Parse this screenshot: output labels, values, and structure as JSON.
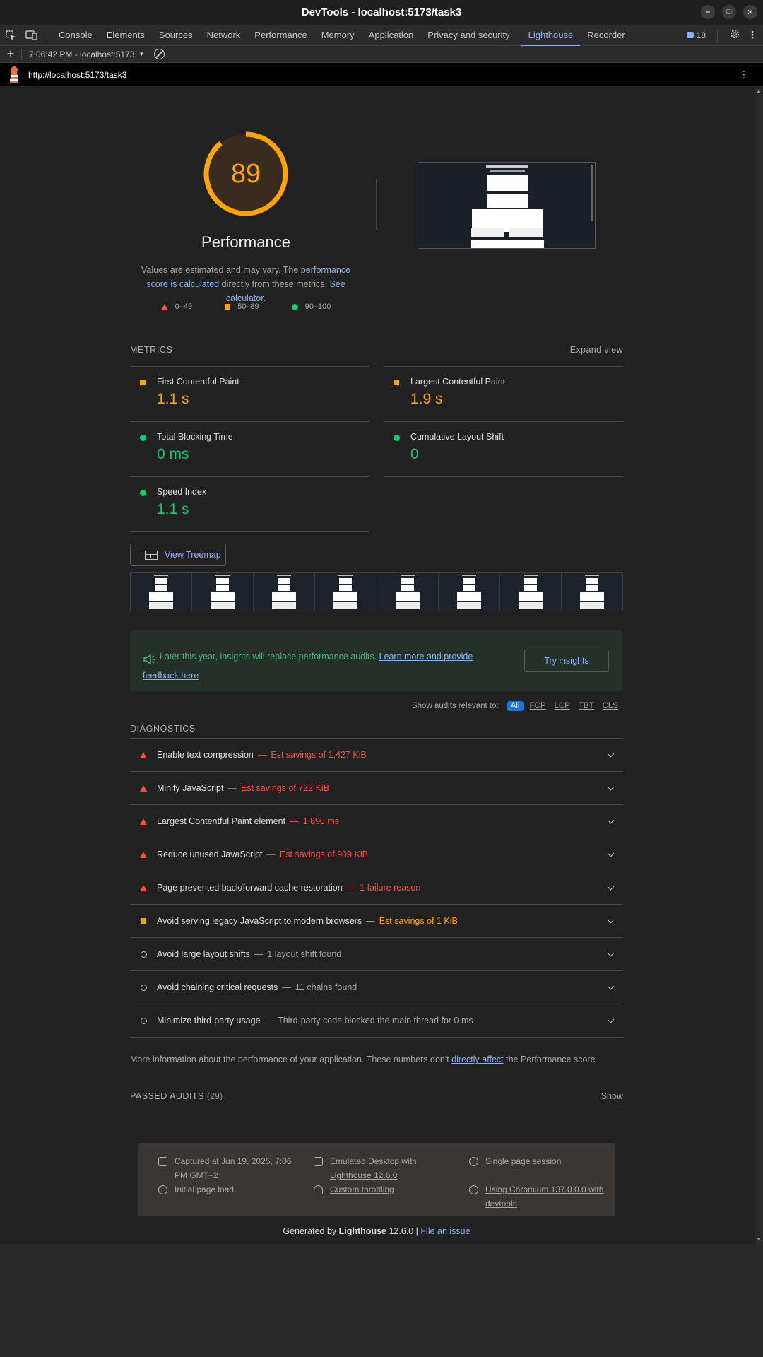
{
  "window": {
    "title": "DevTools - localhost:5173/task3",
    "minimize": "–",
    "maximize": "□",
    "close": "✕"
  },
  "tabs": [
    "Console",
    "Elements",
    "Sources",
    "Network",
    "Performance",
    "Memory",
    "Application",
    "Privacy and security",
    "Lighthouse",
    "Recorder"
  ],
  "active_tab": "Lighthouse",
  "issues_count": "18",
  "toolbar": {
    "run_label": "7:06:42 PM - localhost:5173"
  },
  "url": "http://localhost:5173/task3",
  "gauge": {
    "score": "89",
    "score_value": 89,
    "label": "Performance",
    "desc_pre": "Values are estimated and may vary. The ",
    "desc_link1": "performance score is calculated",
    "desc_mid": " directly from these metrics. ",
    "desc_link2": "See calculator."
  },
  "scale": {
    "fail": "0–49",
    "average": "50–89",
    "pass": "90–100"
  },
  "metrics": {
    "title": "METRICS",
    "expand": "Expand view",
    "fcp_label": "First Contentful Paint",
    "fcp_value": "1.1 s",
    "lcp_label": "Largest Contentful Paint",
    "lcp_value": "1.9 s",
    "tbt_label": "Total Blocking Time",
    "tbt_value": "0 ms",
    "cls_label": "Cumulative Layout Shift",
    "cls_value": "0",
    "si_label": "Speed Index",
    "si_value": "1.1 s"
  },
  "treemap_label": "View Treemap",
  "insights": {
    "text": "Later this year, insights will replace performance audits. ",
    "link": "Learn more and provide feedback here",
    "button": "Try insights"
  },
  "filter": {
    "label": "Show audits relevant to:",
    "chips": [
      "All",
      "FCP",
      "LCP",
      "TBT",
      "CLS"
    ]
  },
  "diagnostics": {
    "title": "DIAGNOSTICS",
    "items": [
      {
        "title": "Enable text compression",
        "detail": "Est savings of 1,427 KiB"
      },
      {
        "title": "Minify JavaScript",
        "detail": "Est savings of 722 KiB"
      },
      {
        "title": "Largest Contentful Paint element",
        "detail": "1,890 ms"
      },
      {
        "title": "Reduce unused JavaScript",
        "detail": "Est savings of 909 KiB"
      },
      {
        "title": "Page prevented back/forward cache restoration",
        "detail": "1 failure reason"
      },
      {
        "title": "Avoid serving legacy JavaScript to modern browsers",
        "detail": "Est savings of 1 KiB"
      },
      {
        "title": "Avoid large layout shifts",
        "detail": "1 layout shift found"
      },
      {
        "title": "Avoid chaining critical requests",
        "detail": "11 chains found"
      },
      {
        "title": "Minimize third-party usage",
        "detail": "Third-party code blocked the main thread for 0 ms"
      }
    ],
    "dash": "—"
  },
  "more_info": {
    "pre": "More information about the performance of your application. These numbers don't ",
    "link": "directly affect",
    "post": " the Performance score."
  },
  "passed": {
    "title": "PASSED AUDITS",
    "count": "(29)",
    "show": "Show"
  },
  "footer": {
    "captured": "Captured at Jun 19, 2025, 7:06 PM GMT+2",
    "load": "Initial page load",
    "emulated": "Emulated Desktop with Lighthouse 12.6.0",
    "throttling": "Custom throttling",
    "session": "Single page session",
    "chromium": "Using Chromium 137.0.0.0 with devtools",
    "generated_pre": "Generated by ",
    "generated_brand": "Lighthouse",
    "generated_ver": " 12.6.0 | ",
    "generated_link": "File an issue"
  },
  "colors": {
    "fail": "#ff4e42",
    "average": "#ffa400",
    "pass": "#0cce6b",
    "link": "#8ab4f8"
  }
}
